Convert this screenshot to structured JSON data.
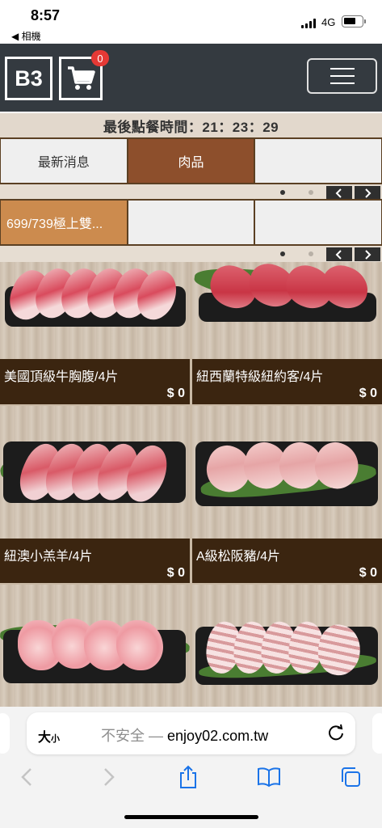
{
  "status_bar": {
    "time": "8:57",
    "back_app": "◀ 相機",
    "network": "4G"
  },
  "header": {
    "logo_text": "B3",
    "cart_count": "0"
  },
  "countdown": {
    "text": "最後點餐時間：21：23：29"
  },
  "categories": [
    {
      "label": "最新消息",
      "active": false
    },
    {
      "label": "肉品",
      "active": true
    },
    {
      "label": "",
      "active": false
    }
  ],
  "subcategories": [
    {
      "label": "699/739極上雙...",
      "active": true
    },
    {
      "label": "",
      "active": false
    },
    {
      "label": "",
      "active": false
    }
  ],
  "pager": {
    "prev": "‹",
    "next": "›"
  },
  "products": [
    {
      "name": "美國頂級牛胸腹/4片",
      "price": "$ 0"
    },
    {
      "name": "紐西蘭特級紐約客/4片",
      "price": "$ 0"
    },
    {
      "name": "紐澳小羔羊/4片",
      "price": "$ 0"
    },
    {
      "name": "A級松阪豬/4片",
      "price": "$ 0"
    },
    {
      "name": "",
      "price": ""
    },
    {
      "name": "",
      "price": ""
    }
  ],
  "safari": {
    "text_size": "大",
    "text_size_small": "小",
    "url_insecure": "不安全 —",
    "url_domain": "enjoy02.com.tw"
  },
  "colors": {
    "header_bg": "#343a40",
    "tab_active": "#8d4f2c",
    "subtab_active": "#cc8b4e",
    "card_bg": "#3b2510",
    "badge": "#e53935"
  }
}
